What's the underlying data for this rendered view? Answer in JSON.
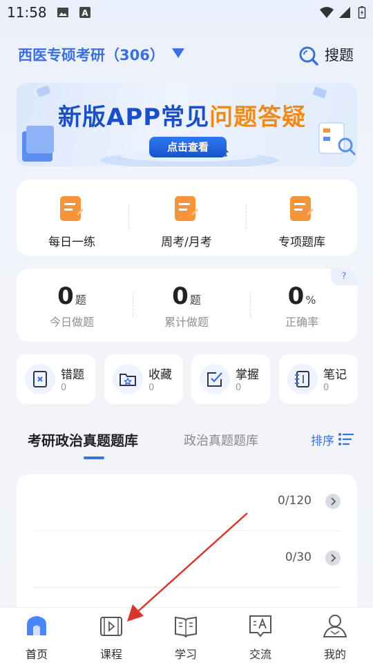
{
  "status_bar": {
    "time": "11:58",
    "icons": [
      "image-icon",
      "a-notification-icon",
      "wifi-icon",
      "signal-icon",
      "battery-icon"
    ]
  },
  "header": {
    "exam_title": "西医专硕考研（306）",
    "search_label": "搜题"
  },
  "banner": {
    "title_part1": "新版APP常见",
    "title_part2": "问题答疑",
    "button_label": "点击查看"
  },
  "quick_actions": [
    {
      "label": "每日一练",
      "icon": "orange-doc-icon"
    },
    {
      "label": "周考/月考",
      "icon": "orange-doc-icon"
    },
    {
      "label": "专项题库",
      "icon": "orange-doc-icon"
    }
  ],
  "stats": {
    "help": "?",
    "items": [
      {
        "value": "0",
        "unit": "题",
        "label": "今日做题"
      },
      {
        "value": "0",
        "unit": "题",
        "label": "累计做题"
      },
      {
        "value": "0",
        "unit": "%",
        "label": "正确率"
      }
    ]
  },
  "tiles": [
    {
      "label": "错题",
      "count": "0",
      "icon": "wrong-question-icon"
    },
    {
      "label": "收藏",
      "count": "0",
      "icon": "favorite-folder-icon"
    },
    {
      "label": "掌握",
      "count": "0",
      "icon": "mastered-check-icon"
    },
    {
      "label": "笔记",
      "count": "0",
      "icon": "notebook-icon"
    }
  ],
  "tabs": {
    "active": "考研政治真题题库",
    "inactive": "政治真题题库",
    "sort_label": "排序"
  },
  "list_rows": [
    {
      "progress": "0/120"
    },
    {
      "progress": "0/30"
    }
  ],
  "bottom_nav": [
    {
      "label": "首页",
      "icon": "home-icon",
      "active": true
    },
    {
      "label": "课程",
      "icon": "course-video-icon",
      "active": false
    },
    {
      "label": "学习",
      "icon": "study-book-icon",
      "active": false
    },
    {
      "label": "交流",
      "icon": "chat-icon",
      "active": false
    },
    {
      "label": "我的",
      "icon": "profile-icon",
      "active": false
    }
  ],
  "colors": {
    "accent": "#3a6fe0",
    "orange": "#f5943a",
    "annotation_arrow": "#d9352b"
  }
}
